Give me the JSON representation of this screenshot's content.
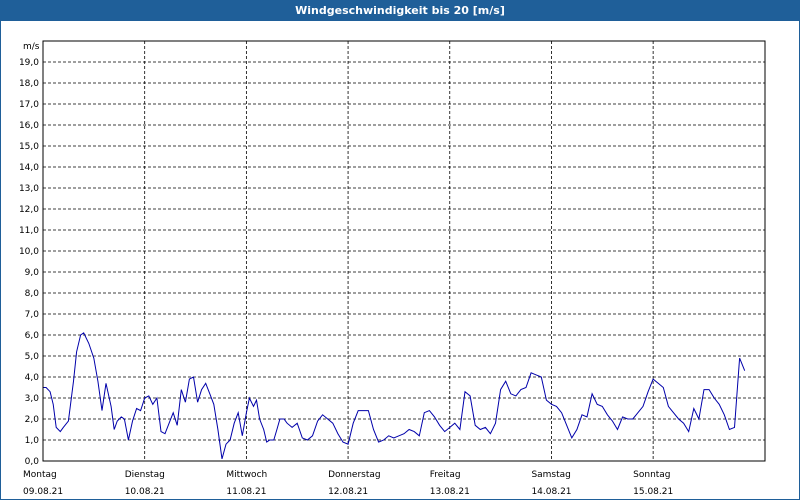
{
  "window": {
    "title": "Windgeschwindigkeit bis 20 [m/s]"
  },
  "chart_data": {
    "type": "line",
    "title": "Windgeschwindigkeit bis 20 [m/s]",
    "ylabel": "m/s",
    "ylim": [
      0,
      20
    ],
    "xlim_days": [
      0,
      7.1
    ],
    "grid": true,
    "y_ticks": [
      "0,0",
      "1,0",
      "2,0",
      "3,0",
      "4,0",
      "5,0",
      "6,0",
      "7,0",
      "8,0",
      "9,0",
      "10,0",
      "11,0",
      "12,0",
      "13,0",
      "14,0",
      "15,0",
      "16,0",
      "17,0",
      "18,0",
      "19,0"
    ],
    "x_categories": [
      {
        "day": "Montag",
        "date": "09.08.21"
      },
      {
        "day": "Dienstag",
        "date": "10.08.21"
      },
      {
        "day": "Mittwoch",
        "date": "11.08.21"
      },
      {
        "day": "Donnerstag",
        "date": "12.08.21"
      },
      {
        "day": "Freitag",
        "date": "13.08.21"
      },
      {
        "day": "Samstag",
        "date": "14.08.21"
      },
      {
        "day": "Sonntag",
        "date": "15.08.21"
      }
    ],
    "series": [
      {
        "color": "#0000aa",
        "x_days": [
          0.0,
          0.03,
          0.07,
          0.1,
          0.13,
          0.17,
          0.2,
          0.25,
          0.3,
          0.33,
          0.37,
          0.4,
          0.45,
          0.5,
          0.54,
          0.58,
          0.62,
          0.67,
          0.7,
          0.73,
          0.77,
          0.8,
          0.84,
          0.88,
          0.92,
          0.96,
          1.0,
          1.04,
          1.08,
          1.12,
          1.16,
          1.2,
          1.24,
          1.28,
          1.32,
          1.36,
          1.4,
          1.44,
          1.48,
          1.52,
          1.56,
          1.6,
          1.64,
          1.68,
          1.72,
          1.76,
          1.8,
          1.84,
          1.88,
          1.92,
          1.96,
          2.0,
          2.03,
          2.07,
          2.1,
          2.13,
          2.17,
          2.2,
          2.23,
          2.27,
          2.3,
          2.33,
          2.37,
          2.4,
          2.45,
          2.5,
          2.55,
          2.6,
          2.65,
          2.7,
          2.75,
          2.8,
          2.85,
          2.9,
          2.95,
          3.0,
          3.05,
          3.1,
          3.15,
          3.2,
          3.25,
          3.3,
          3.35,
          3.4,
          3.45,
          3.5,
          3.55,
          3.6,
          3.65,
          3.7,
          3.75,
          3.8,
          3.85,
          3.9,
          3.95,
          4.0,
          4.05,
          4.1,
          4.15,
          4.2,
          4.25,
          4.3,
          4.35,
          4.4,
          4.45,
          4.5,
          4.55,
          4.6,
          4.65,
          4.7,
          4.75,
          4.8,
          4.85,
          4.9,
          4.95,
          5.0,
          5.05,
          5.1,
          5.15,
          5.2,
          5.25,
          5.3,
          5.35,
          5.4,
          5.45,
          5.5,
          5.55,
          5.6,
          5.65,
          5.7,
          5.75,
          5.8,
          5.85,
          5.9,
          5.95,
          6.0,
          6.05,
          6.1,
          6.15,
          6.2,
          6.25,
          6.3,
          6.35,
          6.4,
          6.45,
          6.5,
          6.55,
          6.6,
          6.65,
          6.7,
          6.75,
          6.8,
          6.85,
          6.9,
          6.95,
          7.0,
          7.05
        ],
        "values": [
          3.5,
          3.5,
          3.3,
          2.7,
          1.6,
          1.4,
          1.6,
          1.9,
          3.8,
          5.2,
          6.0,
          6.1,
          5.6,
          4.9,
          3.8,
          2.4,
          3.7,
          2.6,
          1.5,
          1.9,
          2.1,
          2.0,
          1.0,
          1.9,
          2.5,
          2.4,
          3.0,
          3.1,
          2.7,
          3.0,
          1.4,
          1.3,
          1.8,
          2.3,
          1.7,
          3.4,
          2.8,
          3.9,
          4.0,
          2.8,
          3.4,
          3.7,
          3.2,
          2.7,
          1.5,
          0.1,
          0.8,
          1.0,
          1.8,
          2.3,
          1.2,
          2.3,
          3.0,
          2.6,
          2.9,
          2.0,
          1.5,
          0.9,
          1.0,
          1.0,
          1.5,
          2.0,
          2.0,
          1.8,
          1.6,
          1.8,
          1.1,
          1.0,
          1.2,
          1.9,
          2.2,
          2.0,
          1.8,
          1.3,
          0.9,
          0.8,
          1.8,
          2.4,
          2.4,
          2.4,
          1.5,
          0.9,
          1.0,
          1.2,
          1.1,
          1.2,
          1.3,
          1.5,
          1.4,
          1.2,
          2.3,
          2.4,
          2.1,
          1.7,
          1.4,
          1.6,
          1.8,
          1.5,
          3.3,
          3.1,
          1.7,
          1.5,
          1.6,
          1.3,
          1.8,
          3.4,
          3.8,
          3.2,
          3.1,
          3.4,
          3.5,
          4.2,
          4.1,
          4.0,
          2.9,
          2.7,
          2.6,
          2.3,
          1.7,
          1.1,
          1.5,
          2.2,
          2.1,
          3.2,
          2.7,
          2.6,
          2.2,
          1.9,
          1.5,
          2.1,
          2.0,
          2.0,
          2.3,
          2.6,
          3.3,
          3.9,
          3.7,
          3.5,
          2.6,
          2.3,
          2.0,
          1.8,
          1.4,
          2.5,
          2.0,
          3.4,
          3.4,
          3.0,
          2.7,
          2.2,
          1.5,
          1.6,
          4.9,
          4.3
        ]
      }
    ]
  }
}
